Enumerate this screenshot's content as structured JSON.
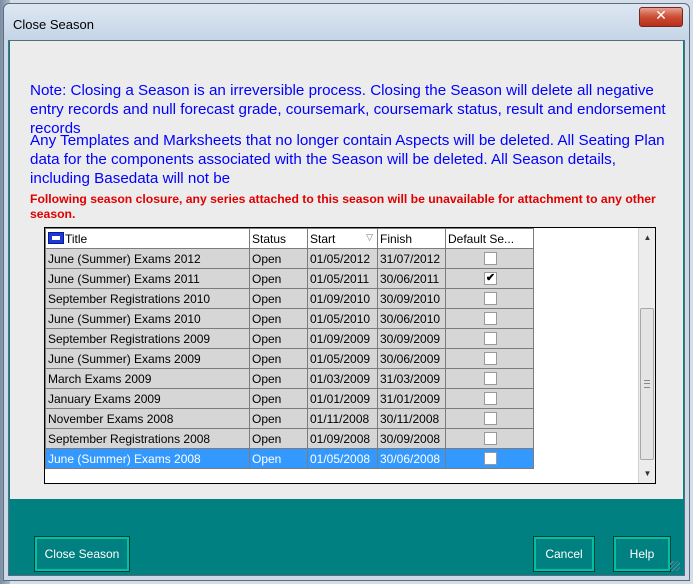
{
  "window": {
    "title": "Close Season",
    "close_glyph": "✕"
  },
  "notes": {
    "note1": "Note: Closing a Season is an irreversible process. Closing the Season will delete all negative entry records and null forecast grade, coursemark, coursemark status, result and endorsement records",
    "note2": "Any Templates and Marksheets that no longer contain Aspects will be deleted. All Seating Plan data for the components associated with the Season will be deleted. All Season details, including Basedata will not be",
    "warning": "Following season closure, any series attached to this season will be unavailable for attachment to any other season."
  },
  "grid": {
    "columns": [
      {
        "key": "title",
        "label": "Title",
        "icon": "table-icon"
      },
      {
        "key": "status",
        "label": "Status"
      },
      {
        "key": "start",
        "label": "Start",
        "sort": "sort-arrow-icon"
      },
      {
        "key": "finish",
        "label": "Finish"
      },
      {
        "key": "default",
        "label": "Default Se..."
      }
    ],
    "rows": [
      {
        "title": "June (Summer) Exams 2012",
        "status": "Open",
        "start": "01/05/2012",
        "finish": "31/07/2012",
        "default": false,
        "selected": false
      },
      {
        "title": "June (Summer) Exams 2011",
        "status": "Open",
        "start": "01/05/2011",
        "finish": "30/06/2011",
        "default": true,
        "selected": false
      },
      {
        "title": "September Registrations 2010",
        "status": "Open",
        "start": "01/09/2010",
        "finish": "30/09/2010",
        "default": false,
        "selected": false
      },
      {
        "title": "June (Summer) Exams 2010",
        "status": "Open",
        "start": "01/05/2010",
        "finish": "30/06/2010",
        "default": false,
        "selected": false
      },
      {
        "title": "September Registrations 2009",
        "status": "Open",
        "start": "01/09/2009",
        "finish": "30/09/2009",
        "default": false,
        "selected": false
      },
      {
        "title": "June (Summer) Exams 2009",
        "status": "Open",
        "start": "01/05/2009",
        "finish": "30/06/2009",
        "default": false,
        "selected": false
      },
      {
        "title": "March Exams 2009",
        "status": "Open",
        "start": "01/03/2009",
        "finish": "31/03/2009",
        "default": false,
        "selected": false
      },
      {
        "title": "January Exams 2009",
        "status": "Open",
        "start": "01/01/2009",
        "finish": "31/01/2009",
        "default": false,
        "selected": false
      },
      {
        "title": "November Exams 2008",
        "status": "Open",
        "start": "01/11/2008",
        "finish": "30/11/2008",
        "default": false,
        "selected": false
      },
      {
        "title": "September Registrations 2008",
        "status": "Open",
        "start": "01/09/2008",
        "finish": "30/09/2008",
        "default": false,
        "selected": false
      },
      {
        "title": "June (Summer) Exams 2008",
        "status": "Open",
        "start": "01/05/2008",
        "finish": "30/06/2008",
        "default": false,
        "selected": true
      }
    ]
  },
  "buttons": {
    "close_season": "Close Season",
    "cancel": "Cancel",
    "help": "Help"
  },
  "colors": {
    "note": "#0000ff",
    "warning": "#e00000",
    "accent": "#008080",
    "selection": "#3399ff"
  }
}
